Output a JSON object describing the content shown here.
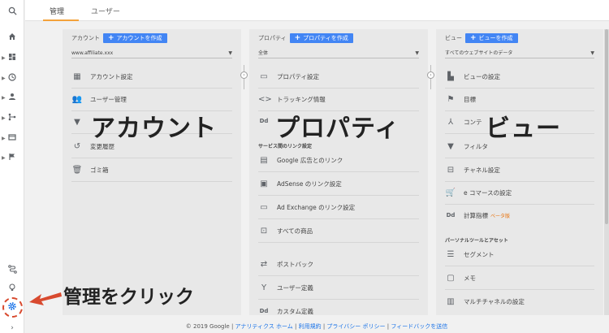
{
  "tabs": [
    {
      "label": "管理"
    },
    {
      "label": "ユーザー"
    }
  ],
  "nav_icons": [
    "search-icon",
    "home-icon",
    "dashboard-icon",
    "clock-icon",
    "person-icon",
    "fork-icon",
    "display-icon",
    "flag-icon",
    "route-icon",
    "lightbulb-icon",
    "gear-icon",
    "expand-icon"
  ],
  "account": {
    "label": "アカウント",
    "create": "アカウントを作成",
    "selector": "www.affiliate.xxx",
    "items": [
      {
        "icon": "building-icon",
        "label": "アカウント設定"
      },
      {
        "icon": "users-icon",
        "label": "ユーザー管理"
      },
      {
        "icon": "filter-icon",
        "label": ""
      },
      {
        "icon": "history-icon",
        "label": "変更履歴"
      },
      {
        "icon": "trash-icon",
        "label": "ゴミ箱"
      }
    ]
  },
  "property": {
    "label": "プロパティ",
    "create": "プロパティを作成",
    "selector": "全体",
    "items": [
      {
        "icon": "page-icon",
        "label": "プロパティ設定"
      },
      {
        "icon": "code-icon",
        "label": "トラッキング情報"
      },
      {
        "icon": "dd-icon",
        "label": ""
      }
    ],
    "section": "サービス間のリンク設定",
    "link_items": [
      {
        "icon": "ads-icon",
        "label": "Google 広告とのリンク"
      },
      {
        "icon": "adsense-icon",
        "label": "AdSense のリンク設定"
      },
      {
        "icon": "adx-icon",
        "label": "Ad Exchange のリンク設定"
      },
      {
        "icon": "products-icon",
        "label": "すべての商品"
      }
    ],
    "more_items": [
      {
        "icon": "postback-icon",
        "label": "ポストバック"
      },
      {
        "icon": "user-def-icon",
        "label": "ユーザー定義"
      },
      {
        "icon": "dd-icon",
        "label": "カスタム定義"
      }
    ]
  },
  "view": {
    "label": "ビュー",
    "create": "ビューを作成",
    "selector": "すべてのウェブサイトのデータ",
    "items": [
      {
        "icon": "doc-icon",
        "label": "ビューの設定"
      },
      {
        "icon": "flag-icon",
        "label": "目標"
      },
      {
        "icon": "content-icon",
        "label": "コンテ"
      },
      {
        "icon": "filter-icon",
        "label": "フィルタ"
      },
      {
        "icon": "channel-icon",
        "label": "チャネル設定"
      },
      {
        "icon": "cart-icon",
        "label": "e コマースの設定"
      },
      {
        "icon": "dd-icon",
        "label": "計算指標",
        "beta": "ベータ版"
      }
    ],
    "section": "パーソナルツールとアセット",
    "tool_items": [
      {
        "icon": "segment-icon",
        "label": "セグメント"
      },
      {
        "icon": "memo-icon",
        "label": "メモ"
      },
      {
        "icon": "multichannel-icon",
        "label": "マルチチャネルの設定"
      }
    ]
  },
  "overlays": {
    "account": "アカウント",
    "property": "プロパティ",
    "view": "ビュー",
    "click_note": "管理をクリック"
  },
  "footer": {
    "copyright": "© 2019 Google",
    "links": [
      "アナリティクス ホーム",
      "利用規約",
      "プライバシー ポリシー",
      "フィードバックを送信"
    ]
  },
  "colors": {
    "accent": "#4285f4",
    "tab_underline": "#f4a23b",
    "annotation": "#d84a2f"
  }
}
